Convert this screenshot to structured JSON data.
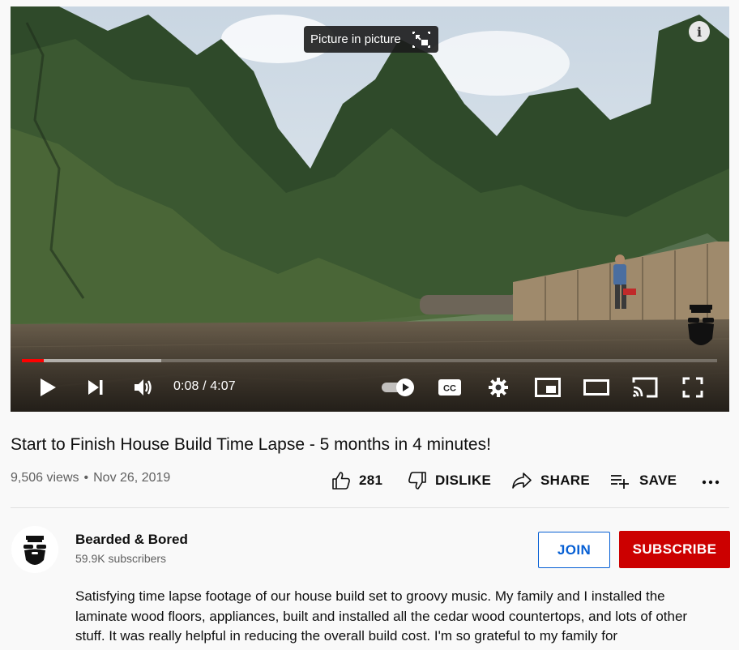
{
  "player": {
    "tooltip": "Picture in picture",
    "info_label": "i",
    "current_time": "0:08",
    "duration": "4:07",
    "played_fraction": 0.032,
    "loaded_fraction": 0.2
  },
  "video": {
    "title": "Start to Finish House Build Time Lapse - 5 months in 4 minutes!",
    "views": "9,506 views",
    "date": "Nov 26, 2019"
  },
  "actions": {
    "like_count": "281",
    "dislike_label": "DISLIKE",
    "share_label": "SHARE",
    "save_label": "SAVE"
  },
  "channel": {
    "name": "Bearded & Bored",
    "subscribers": "59.9K subscribers",
    "join_label": "JOIN",
    "subscribe_label": "SUBSCRIBE"
  },
  "description": "Satisfying time lapse footage of our house build set to groovy music. My family and I installed the laminate wood floors, appliances, built and installed all the cedar wood countertops, and lots of other stuff. It was really helpful in reducing the overall build cost. I'm so grateful to my family for",
  "colors": {
    "accent_red": "#ff0000",
    "subscribe_red": "#cc0000",
    "join_blue": "#065fd4"
  }
}
